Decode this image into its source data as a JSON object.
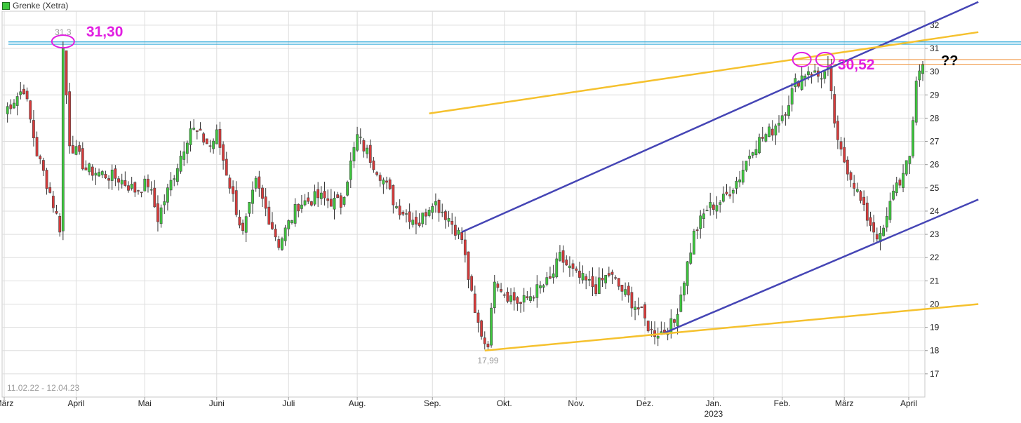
{
  "legend": {
    "label": "Grenke (Xetra)"
  },
  "colors": {
    "up": "#3dc73d",
    "down": "#d83a3a",
    "grid": "#dddddd",
    "trend_blue": "#4545b5",
    "trend_yellow": "#f5c12e",
    "annot_magenta": "#e11ee1",
    "res_blue": "#2aa7d8",
    "res_orange": "#f09a4a"
  },
  "chart_data": {
    "type": "candlestick",
    "title": "Grenke (Xetra)",
    "date_range": "11.02.22 - 12.04.23",
    "y_ticks": [
      17,
      18,
      19,
      20,
      21,
      22,
      23,
      24,
      25,
      26,
      27,
      28,
      29,
      30,
      31,
      32
    ],
    "ylim": [
      16.0,
      32.6
    ],
    "x_ticks": [
      {
        "label": "März",
        "sub": ""
      },
      {
        "label": "April",
        "sub": ""
      },
      {
        "label": "Mai",
        "sub": ""
      },
      {
        "label": "Juni",
        "sub": ""
      },
      {
        "label": "Juli",
        "sub": ""
      },
      {
        "label": "Aug.",
        "sub": ""
      },
      {
        "label": "Sep.",
        "sub": ""
      },
      {
        "label": "Okt.",
        "sub": ""
      },
      {
        "label": "Nov.",
        "sub": ""
      },
      {
        "label": "Dez.",
        "sub": ""
      },
      {
        "label": "Jan.",
        "sub": "2023"
      },
      {
        "label": "Feb.",
        "sub": ""
      },
      {
        "label": "März",
        "sub": ""
      },
      {
        "label": "April",
        "sub": ""
      }
    ],
    "annotations": {
      "high_label": "31,3",
      "low_label": "17,99",
      "high_callout": "31,30",
      "recent_callout": "30,52",
      "question": "??"
    },
    "price_path": [
      [
        0,
        28.3
      ],
      [
        6,
        29.3
      ],
      [
        10,
        26.5
      ],
      [
        14,
        24.8
      ],
      [
        17,
        23.3
      ],
      [
        18,
        31.0
      ],
      [
        20,
        27.0
      ],
      [
        25,
        25.8
      ],
      [
        35,
        25.4
      ],
      [
        40,
        24.9
      ],
      [
        44,
        25.2
      ],
      [
        47,
        23.7
      ],
      [
        53,
        26.0
      ],
      [
        57,
        27.6
      ],
      [
        63,
        26.8
      ],
      [
        65,
        27.3
      ],
      [
        70,
        24.6
      ],
      [
        73,
        23.0
      ],
      [
        77,
        25.2
      ],
      [
        84,
        22.6
      ],
      [
        90,
        24.3
      ],
      [
        96,
        24.6
      ],
      [
        103,
        24.3
      ],
      [
        108,
        27.2
      ],
      [
        115,
        25.6
      ],
      [
        120,
        24.2
      ],
      [
        127,
        23.5
      ],
      [
        131,
        24.5
      ],
      [
        136,
        23.7
      ],
      [
        140,
        22.8
      ],
      [
        144,
        19.5
      ],
      [
        148,
        18.0
      ],
      [
        150,
        21.2
      ],
      [
        153,
        20.5
      ],
      [
        158,
        20.0
      ],
      [
        162,
        20.5
      ],
      [
        167,
        21.0
      ],
      [
        170,
        22.0
      ],
      [
        175,
        21.2
      ],
      [
        181,
        20.7
      ],
      [
        185,
        21.3
      ],
      [
        190,
        20.4
      ],
      [
        194,
        19.8
      ],
      [
        198,
        18.8
      ],
      [
        201,
        18.8
      ],
      [
        205,
        19.2
      ],
      [
        208,
        21.1
      ],
      [
        211,
        23.0
      ],
      [
        215,
        24.1
      ],
      [
        220,
        24.5
      ],
      [
        225,
        25.5
      ],
      [
        229,
        26.8
      ],
      [
        235,
        27.5
      ],
      [
        239,
        28.4
      ],
      [
        242,
        29.5
      ],
      [
        246,
        30.1
      ],
      [
        249,
        29.8
      ],
      [
        252,
        30.0
      ],
      [
        253,
        28.9
      ],
      [
        255,
        26.8
      ],
      [
        260,
        25.2
      ],
      [
        263,
        24.0
      ],
      [
        266,
        23.2
      ],
      [
        268,
        22.8
      ],
      [
        270,
        23.6
      ],
      [
        272,
        25.0
      ],
      [
        275,
        25.5
      ],
      [
        277,
        26.3
      ],
      [
        279,
        29.7
      ],
      [
        281,
        30.3
      ]
    ],
    "trendlines": [
      {
        "color": "blue",
        "from": [
          140,
          23.1
        ],
        "to": [
          298,
          33.0
        ]
      },
      {
        "color": "blue",
        "from": [
          201,
          18.7
        ],
        "to": [
          298,
          24.5
        ]
      },
      {
        "color": "yellow",
        "from": [
          130,
          28.2
        ],
        "to": [
          298,
          31.7
        ]
      },
      {
        "color": "yellow",
        "from": [
          147,
          18.0
        ],
        "to": [
          298,
          20.0
        ]
      }
    ]
  }
}
